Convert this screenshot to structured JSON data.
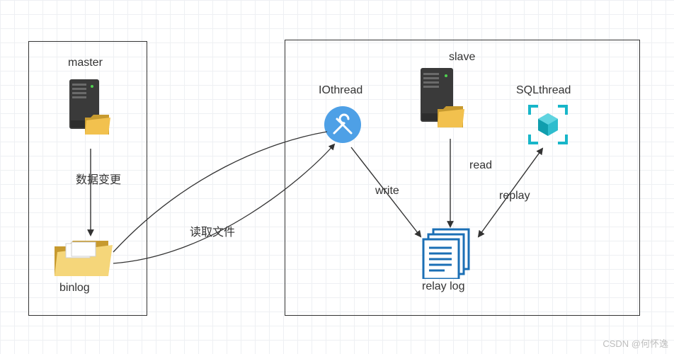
{
  "diagram": {
    "master": {
      "title": "master",
      "data_change": "数据变更",
      "binlog": "binlog"
    },
    "slave": {
      "title": "slave",
      "io_thread": "IOthread",
      "sql_thread": "SQLthread",
      "write": "write",
      "read": "read",
      "replay": "replay",
      "relay_log": "relay log",
      "read_file": "读取文件"
    },
    "watermark": "CSDN @何怀逸"
  }
}
